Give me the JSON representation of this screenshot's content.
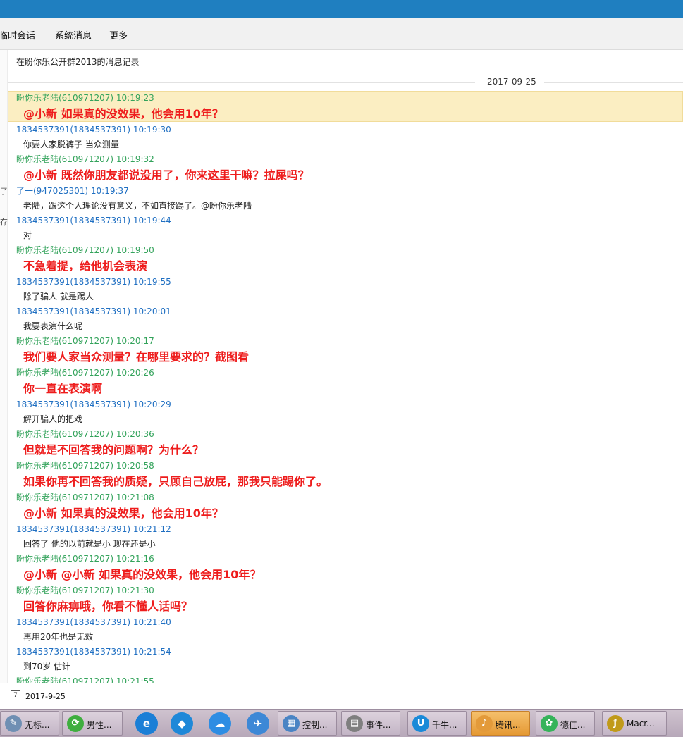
{
  "menu": {
    "items": [
      "临时会话",
      "系统消息",
      "更多"
    ]
  },
  "left_fragments": [
    "了",
    "存"
  ],
  "history": {
    "title": "在盼你乐公开群2013的消息记录",
    "date": "2017-09-25"
  },
  "messages": [
    {
      "sender": "盼你乐老陆(610971207) 10:19:23",
      "sender_color": "green",
      "text": "@小新 如果真的没效果，他会用10年？",
      "emphasis": true
    },
    {
      "sender": "1834537391(1834537391) 10:19:30",
      "sender_color": "blue",
      "text": "你要人家脱裤子 当众测量",
      "emphasis": false
    },
    {
      "sender": "盼你乐老陆(610971207) 10:19:32",
      "sender_color": "green",
      "text": "@小新  既然你朋友都说没用了，你来这里干嘛？拉屎吗？",
      "emphasis": true
    },
    {
      "sender": "了一(947025301) 10:19:37",
      "sender_color": "blue",
      "text": "老陆，跟这个人理论没有意义，不如直接踢了。@盼你乐老陆",
      "emphasis": false
    },
    {
      "sender": "1834537391(1834537391) 10:19:44",
      "sender_color": "blue",
      "text": "对",
      "emphasis": false
    },
    {
      "sender": "盼你乐老陆(610971207) 10:19:50",
      "sender_color": "green",
      "text": "不急着提，给他机会表演",
      "emphasis": true
    },
    {
      "sender": "1834537391(1834537391) 10:19:55",
      "sender_color": "blue",
      "text": "除了骗人 就是踢人",
      "emphasis": false
    },
    {
      "sender": "1834537391(1834537391) 10:20:01",
      "sender_color": "blue",
      "text": "我要表演什么呢",
      "emphasis": false
    },
    {
      "sender": "盼你乐老陆(610971207) 10:20:17",
      "sender_color": "green",
      "text": "我们要人家当众测量？在哪里要求的？截图看",
      "emphasis": true
    },
    {
      "sender": "盼你乐老陆(610971207) 10:20:26",
      "sender_color": "green",
      "text": "你一直在表演啊",
      "emphasis": true
    },
    {
      "sender": "1834537391(1834537391) 10:20:29",
      "sender_color": "blue",
      "text": "解开骗人的把戏",
      "emphasis": false
    },
    {
      "sender": "盼你乐老陆(610971207) 10:20:36",
      "sender_color": "green",
      "text": "但就是不回答我的问题啊？为什么？",
      "emphasis": true
    },
    {
      "sender": "盼你乐老陆(610971207) 10:20:58",
      "sender_color": "green",
      "text": "如果你再不回答我的质疑，只顾自己放屁，那我只能踢你了。",
      "emphasis": true
    },
    {
      "sender": "盼你乐老陆(610971207) 10:21:08",
      "sender_color": "green",
      "text": "@小新 如果真的没效果，他会用10年？",
      "emphasis": true
    },
    {
      "sender": "1834537391(1834537391) 10:21:12",
      "sender_color": "blue",
      "text": "回答了   他的以前就是小  现在还是小",
      "emphasis": false
    },
    {
      "sender": "盼你乐老陆(610971207) 10:21:16",
      "sender_color": "green",
      "text": "@小新 @小新 如果真的没效果，他会用10年？",
      "emphasis": true
    },
    {
      "sender": "盼你乐老陆(610971207) 10:21:30",
      "sender_color": "green",
      "text": "回答你麻痹哦，你看不懂人话吗？",
      "emphasis": true
    },
    {
      "sender": "1834537391(1834537391) 10:21:40",
      "sender_color": "blue",
      "text": "再用20年也是无效",
      "emphasis": false
    },
    {
      "sender": "1834537391(1834537391) 10:21:54",
      "sender_color": "blue",
      "text": "到70岁 估计",
      "emphasis": false
    },
    {
      "sender": "盼你乐老陆(610971207) 10:21:55",
      "sender_color": "green",
      "text": "",
      "emphasis": false
    }
  ],
  "footer": {
    "calendar_glyph": "7",
    "date": "2017-9-25"
  },
  "taskbar": {
    "items": [
      {
        "icon": "notepad-icon",
        "label": "无标...",
        "color": "#6f8fb3",
        "glyph": "✎"
      },
      {
        "icon": "browser-green-icon",
        "label": "男性...",
        "color": "#3fae3f",
        "glyph": "⟳"
      },
      {
        "icon": "ie-icon",
        "label": "",
        "color": "#1b7fd6",
        "glyph": "e"
      },
      {
        "icon": "compass-icon",
        "label": "",
        "color": "#1e88d8",
        "glyph": "◆"
      },
      {
        "icon": "cloud-icon",
        "label": "",
        "color": "#2d8de3",
        "glyph": "☁"
      },
      {
        "icon": "bird-icon",
        "label": "",
        "color": "#3d88d6",
        "glyph": "✈"
      },
      {
        "icon": "control-panel-icon",
        "label": "控制...",
        "color": "#4a84c4",
        "glyph": "▦"
      },
      {
        "icon": "event-viewer-icon",
        "label": "事件...",
        "color": "#7f7f7f",
        "glyph": "▤"
      },
      {
        "icon": "qianniu-icon",
        "label": "千牛...",
        "color": "#1a8ad8",
        "glyph": "U"
      },
      {
        "icon": "speaker-icon",
        "label": "腾讯...",
        "color": "#e39a3a",
        "glyph": "♪"
      },
      {
        "icon": "dejia-icon",
        "label": "德佳...",
        "color": "#36b35a",
        "glyph": "✿"
      },
      {
        "icon": "macromedia-icon",
        "label": "Macr...",
        "color": "#c09a1a",
        "glyph": "ƒ"
      }
    ]
  }
}
